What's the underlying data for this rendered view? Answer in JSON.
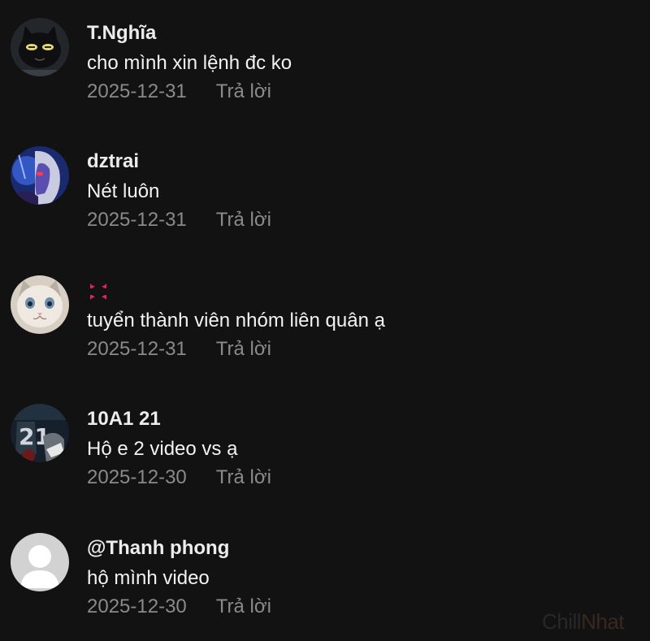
{
  "comments": [
    {
      "username": "T.Nghĩa",
      "text": "cho mình xin lệnh đc ko",
      "date": "2025-12-31",
      "reply": "Trả lời",
      "avatar_icon": "black-cat-avatar"
    },
    {
      "username": "dztrai",
      "text": "Nét luôn",
      "date": "2025-12-31",
      "reply": "Trả lời",
      "avatar_icon": "anime-character-avatar"
    },
    {
      "username": "",
      "username_icon": "anger-symbol-emoji",
      "text": "tuyển thành viên nhóm liên quân ạ",
      "date": "2025-12-31",
      "reply": "Trả lời",
      "avatar_icon": "kitten-avatar"
    },
    {
      "username": "10A1 21",
      "text": "Hộ e 2 video vs ạ",
      "date": "2025-12-30",
      "reply": "Trả lời",
      "avatar_icon": "jersey-21-avatar"
    },
    {
      "username": "@Thanh phong",
      "text": "hộ mình video",
      "date": "2025-12-30",
      "reply": "Trả lời",
      "avatar_icon": "default-user-avatar"
    }
  ],
  "watermark": {
    "part1": "Chill",
    "part2": "Nhat"
  },
  "colors": {
    "background": "#121212",
    "text": "#ececec",
    "meta": "#8a8a8a",
    "anger": "#e0245e"
  }
}
